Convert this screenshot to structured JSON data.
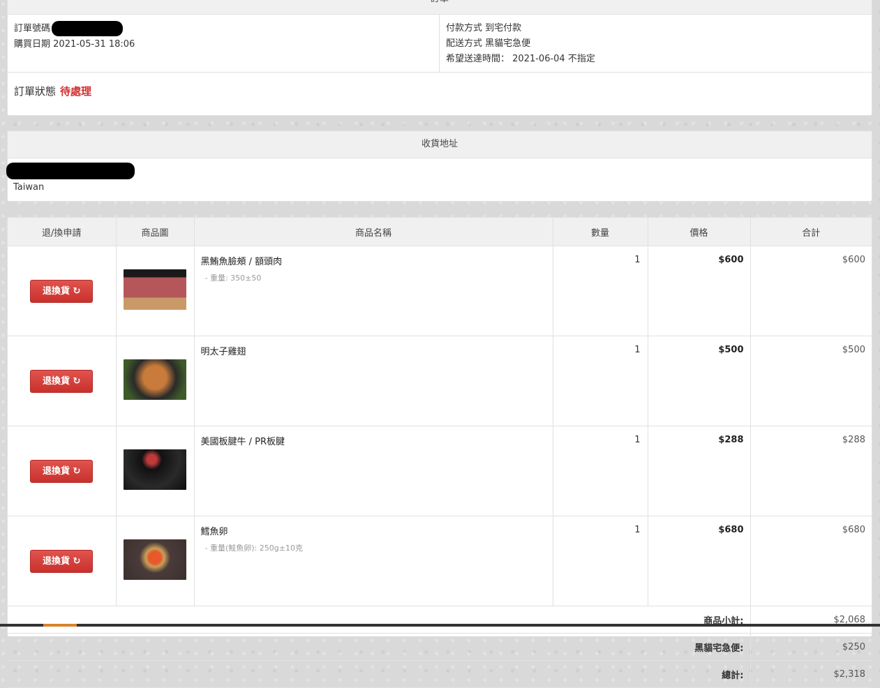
{
  "order": {
    "header": "訂單",
    "number_label": "訂單號碼",
    "date_label": "購買日期",
    "date_value": "2021-05-31 18:06",
    "payment_label": "付款方式",
    "payment_value": "到宅付款",
    "shipping_label": "配送方式",
    "shipping_value": "黑貓宅急便",
    "delivery_label": "希望送達時間：",
    "delivery_value": "2021-06-04 不指定",
    "status_label": "訂單狀態",
    "status_value": "待處理"
  },
  "address": {
    "header": "收貨地址",
    "country": "Taiwan"
  },
  "table": {
    "headers": [
      "退/換申請",
      "商品圖",
      "商品名稱",
      "數量",
      "價格",
      "合計"
    ],
    "return_button_label": "退換貨 ↻",
    "items": [
      {
        "name": "黑鮪魚臉頰 / 額頭肉",
        "option": "- 重量: 350±50",
        "qty": "1",
        "price": "$600",
        "total": "$600",
        "thumb_color": "#8a3a35"
      },
      {
        "name": "明太子雞翅",
        "option": "",
        "qty": "1",
        "price": "$500",
        "total": "$500",
        "thumb_color": "#7a4a20"
      },
      {
        "name": "美國板腱牛 / PR板腱",
        "option": "",
        "qty": "1",
        "price": "$288",
        "total": "$288",
        "thumb_color": "#1c1c1c"
      },
      {
        "name": "鱈魚卵",
        "option": "- 重量(鮭魚卵): 250g±10克",
        "qty": "1",
        "price": "$680",
        "total": "$680",
        "thumb_color": "#4a3a38"
      }
    ],
    "subtotal_label": "商品小計:",
    "subtotal_value": "$2,068",
    "shipping_fee_label": "黑貓宅急便:",
    "shipping_fee_value": "$250",
    "grand_total_label": "總計:",
    "grand_total_value": "$2,318"
  },
  "colors": {
    "status_red": "#d32f2f",
    "button_red": "#d9534f"
  }
}
